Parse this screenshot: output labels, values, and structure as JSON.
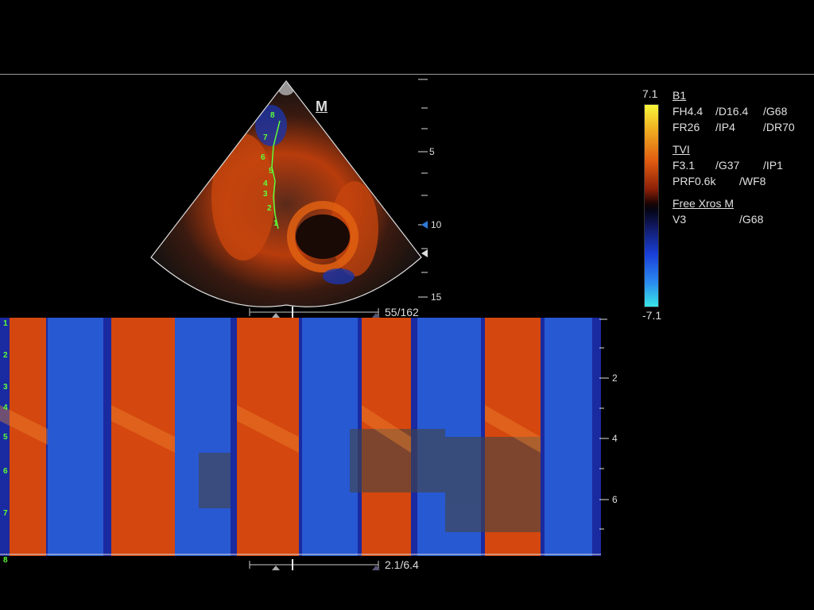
{
  "image_mode": {
    "marker": "M",
    "depth_labels": [
      "5",
      "10",
      "15"
    ],
    "track_numbers": [
      "1",
      "2",
      "3",
      "4",
      "5",
      "6",
      "7",
      "8"
    ]
  },
  "slider_top": {
    "text": "55/162"
  },
  "slider_bottom": {
    "text": "2.1/6.4"
  },
  "mmode": {
    "track_labels": [
      "1",
      "2",
      "3",
      "4",
      "5",
      "6",
      "7",
      "8"
    ],
    "depth_labels": [
      "2",
      "4",
      "6"
    ]
  },
  "colorbar": {
    "max": "7.1",
    "min": "-7.1"
  },
  "params": {
    "b1": {
      "header": "B1",
      "rows": [
        [
          "FH4.4",
          "/D16.4",
          "/G68"
        ],
        [
          "FR26",
          "/IP4",
          "/DR70"
        ]
      ]
    },
    "tvi": {
      "header": "TVI",
      "rows": [
        [
          "F3.1",
          "/G37",
          "/IP1"
        ],
        [
          "PRF0.6k",
          "/WF8",
          ""
        ]
      ]
    },
    "xros": {
      "header": "Free Xros M",
      "rows": [
        [
          "V3",
          "/G68",
          ""
        ]
      ]
    }
  },
  "colors": {
    "trace": "#5cff3a",
    "marker": "#2f7ad8",
    "red_flow": "#d9480f",
    "blue_flow": "#1f47c8"
  }
}
